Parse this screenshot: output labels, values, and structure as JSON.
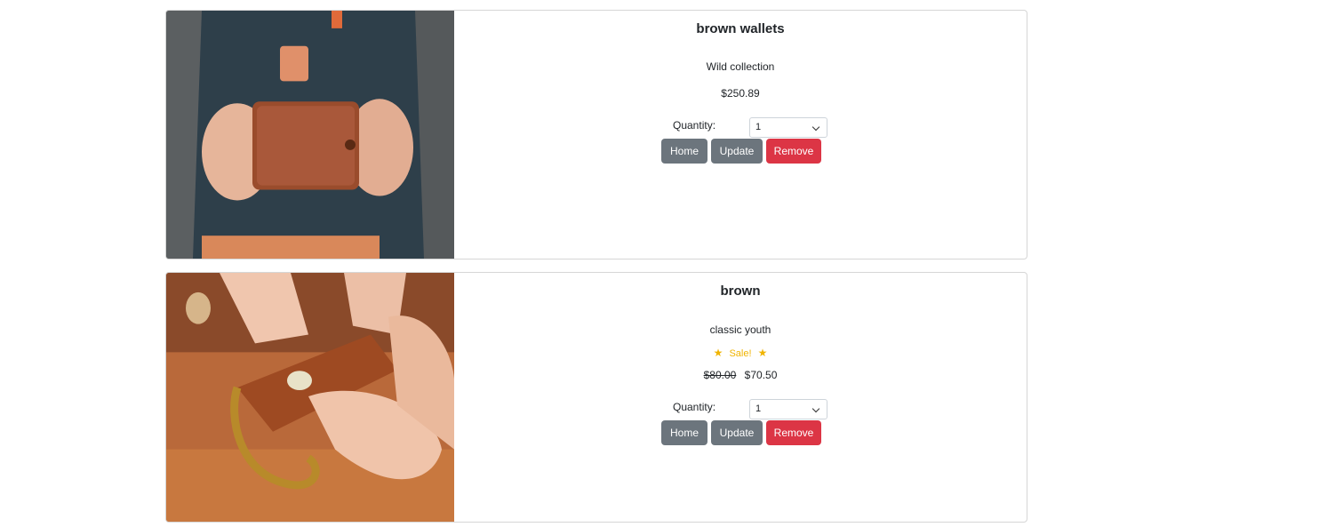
{
  "cart": {
    "items": [
      {
        "title": "brown wallets",
        "description": "Wild collection",
        "price": "$250.89",
        "quantity_label": "Quantity:",
        "quantity_value": "1",
        "buttons": {
          "home": "Home",
          "update": "Update",
          "remove": "Remove"
        }
      },
      {
        "title": "brown",
        "description": "classic youth",
        "sale_label": "Sale!",
        "old_price": "$80.00",
        "price": "$70.50",
        "quantity_label": "Quantity:",
        "quantity_value": "1",
        "buttons": {
          "home": "Home",
          "update": "Update",
          "remove": "Remove"
        }
      }
    ]
  },
  "colors": {
    "secondary_button": "#6c757d",
    "danger_button": "#dc3545",
    "sale_star": "#f0b400"
  }
}
